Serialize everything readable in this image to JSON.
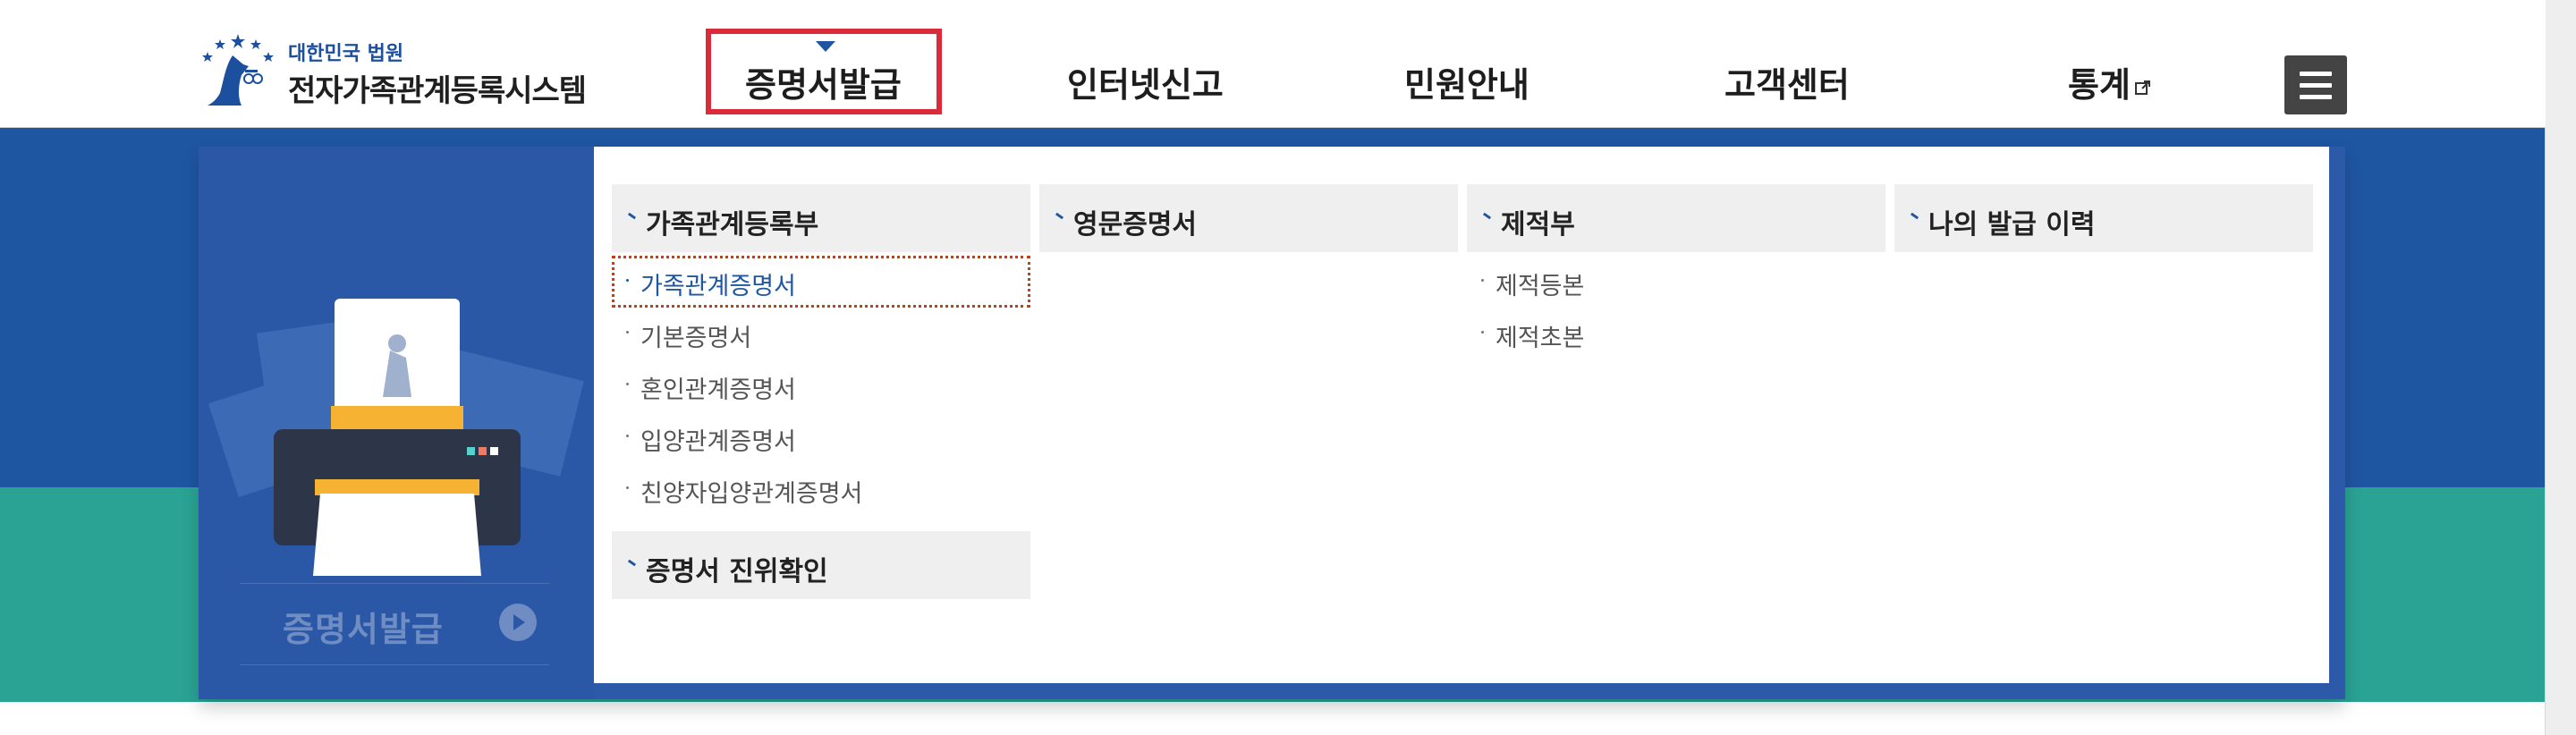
{
  "logo": {
    "subtitle": "대한민국 법원",
    "title": "전자가족관계등록시스템"
  },
  "nav": {
    "items": [
      {
        "label": "증명서발급",
        "active": true
      },
      {
        "label": "인터넷신고"
      },
      {
        "label": "민원안내"
      },
      {
        "label": "고객센터"
      },
      {
        "label": "통계",
        "external": true
      }
    ],
    "menu_icon": "hamburger-icon"
  },
  "mega_menu": {
    "side_label": "증명서발급",
    "columns": [
      {
        "heading": "가족관계등록부",
        "items": [
          "가족관계증명서",
          "기본증명서",
          "혼인관계증명서",
          "입양관계증명서",
          "친양자입양관계증명서"
        ],
        "focused_index": 0,
        "second_heading": "증명서 진위확인"
      },
      {
        "heading": "영문증명서",
        "items": []
      },
      {
        "heading": "제적부",
        "items": [
          "제적등본",
          "제적초본"
        ]
      },
      {
        "heading": "나의 발급 이력",
        "items": []
      }
    ]
  },
  "colors": {
    "brand_blue": "#1f56a2",
    "active_border": "#d92b3a",
    "teal_band": "#2aa394",
    "focus_outline": "#c63d1a"
  }
}
